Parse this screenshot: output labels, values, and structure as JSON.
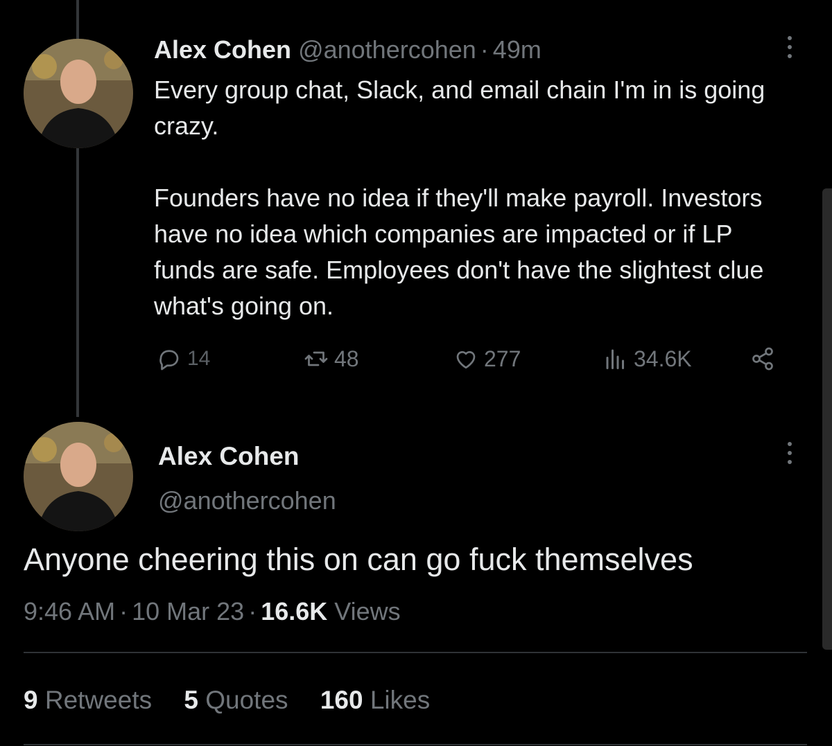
{
  "tweet": {
    "author_name": "Alex Cohen",
    "handle": "@anothercohen",
    "separator": "·",
    "age": "49m",
    "paragraphs": [
      "Every group chat, Slack, and email chain I'm in is going crazy.",
      "Founders have no idea if they'll make payroll. Investors have no idea which companies are impacted or if LP funds are safe. Employees don't have the slightest clue what's going on."
    ],
    "actions": {
      "replies": "14",
      "retweets": "48",
      "likes": "277",
      "views": "34.6K"
    }
  },
  "reply": {
    "author_name": "Alex Cohen",
    "handle": "@anothercohen",
    "text": "Anyone cheering this on can go fuck themselves",
    "time": "9:46 AM",
    "date": "10 Mar 23",
    "separator": "·",
    "views_count": "16.6K",
    "views_label": "Views",
    "stats": {
      "retweets_count": "9",
      "retweets_label": "Retweets",
      "quotes_count": "5",
      "quotes_label": "Quotes",
      "likes_count": "160",
      "likes_label": "Likes"
    }
  },
  "icons": {
    "reply": "reply-icon",
    "retweet": "retweet-icon",
    "like": "heart-icon",
    "views": "views-icon",
    "share": "share-icon",
    "more": "more-icon"
  },
  "colors": {
    "background": "#000000",
    "text": "#e7e9ea",
    "muted": "#71767b",
    "divider": "#2f3336"
  }
}
